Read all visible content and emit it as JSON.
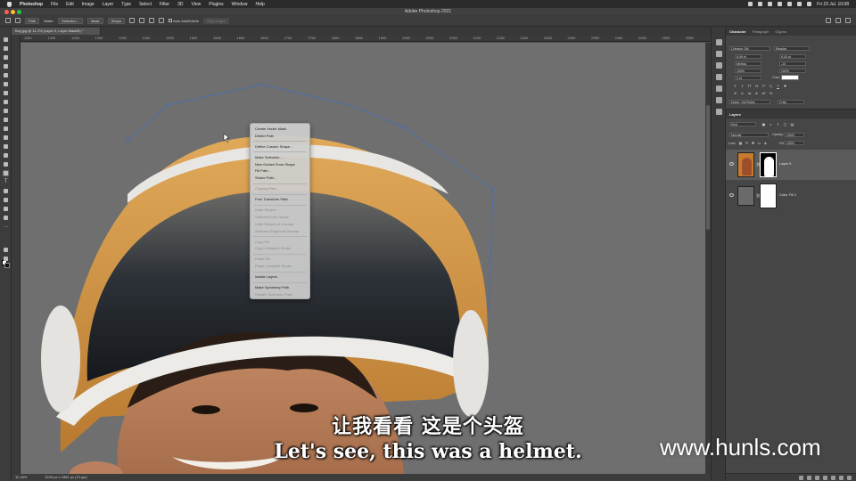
{
  "menubar": {
    "app_name": "Photoshop",
    "items": [
      "File",
      "Edit",
      "Image",
      "Layer",
      "Type",
      "Select",
      "Filter",
      "3D",
      "View",
      "Plugins",
      "Window",
      "Help"
    ],
    "clock": "Fri 23 Jul. 10:08"
  },
  "window": {
    "title": "Adobe Photoshop 2021"
  },
  "options_bar": {
    "mode_value": "Path",
    "make_label": "Make:",
    "selection_button": "Selection...",
    "mask_button": "Mask",
    "shape_button": "Shape",
    "auto_add_delete_label": "Auto Add/Delete",
    "align_edges_label": "Align Edges"
  },
  "document": {
    "tab_title": "Boy.jpg @ 11.2% (Layer 0, Layer Mask/8) *",
    "ruler_ticks": [
      "1150",
      "1200",
      "1250",
      "1300",
      "1350",
      "1400",
      "1450",
      "1500",
      "1550",
      "1600",
      "1650",
      "1700",
      "1750",
      "1800",
      "1850",
      "1900",
      "1950",
      "2000",
      "2050",
      "2100",
      "2150",
      "2200",
      "2250",
      "2300",
      "2350",
      "2400",
      "2450",
      "2500",
      "2550"
    ],
    "zoom": "11.18%",
    "doc_size": "3243 px x 4361 px (72 ppi)"
  },
  "context_menu": {
    "groups": [
      [
        {
          "label": "Create Vector Mask",
          "enabled": true
        },
        {
          "label": "Delete Path",
          "enabled": true
        }
      ],
      [
        {
          "label": "Define Custom Shape...",
          "enabled": true
        }
      ],
      [
        {
          "label": "Make Selection...",
          "enabled": true
        },
        {
          "label": "New Guides From Shape",
          "enabled": true
        },
        {
          "label": "Fill Path...",
          "enabled": true
        },
        {
          "label": "Stroke Path...",
          "enabled": true
        }
      ],
      [
        {
          "label": "Clipping Path...",
          "enabled": false
        }
      ],
      [
        {
          "label": "Free Transform Path",
          "enabled": true
        }
      ],
      [
        {
          "label": "Unite Shapes",
          "enabled": false
        },
        {
          "label": "Subtract Front Shape",
          "enabled": false
        },
        {
          "label": "Unite Shapes at Overlap",
          "enabled": false
        },
        {
          "label": "Subtract Shapes at Overlap",
          "enabled": false
        }
      ],
      [
        {
          "label": "Copy Fill",
          "enabled": false
        },
        {
          "label": "Copy Complete Stroke",
          "enabled": false
        }
      ],
      [
        {
          "label": "Paste Fill",
          "enabled": false
        },
        {
          "label": "Paste Complete Stroke",
          "enabled": false
        }
      ],
      [
        {
          "label": "Isolate Layers",
          "enabled": true
        }
      ],
      [
        {
          "label": "Make Symmetry Path",
          "enabled": true
        },
        {
          "label": "Disable Symmetry Path",
          "enabled": false
        }
      ]
    ]
  },
  "character_panel": {
    "tabs": [
      "Character",
      "Paragraph",
      "Glyphs"
    ],
    "font_family": "Crimson Old",
    "font_style": "Regular",
    "font_size": "6.49 pt",
    "leading": "6.43 pt",
    "kerning": "Metrics",
    "tracking": "-10",
    "vertical_scale": "100%",
    "horizontal_scale": "100%",
    "baseline_shift": "0 pt",
    "color_label": "Color:",
    "format_buttons": [
      "T",
      "T",
      "TT",
      "Tt",
      "T¹",
      "T₁",
      "T",
      "T"
    ],
    "language": "Dutch: Old Rules",
    "antialias": "Crisp"
  },
  "layers_panel": {
    "title": "Layers",
    "kind_filter": "Kind",
    "blend_mode": "Normal",
    "opacity_label": "Opacity:",
    "opacity_value": "100%",
    "lock_label": "Lock:",
    "fill_label": "Fill:",
    "fill_value": "100%",
    "layers": [
      {
        "name": "Layer 0",
        "selected": true
      },
      {
        "name": "Color Fill 1",
        "selected": false
      }
    ]
  },
  "subtitles": {
    "chinese": "让我看看 这是个头盔",
    "english": "Let's see, this was a helmet."
  },
  "watermark": "www.hunls.com",
  "colors": {
    "canvas_bg": "#6f6f6f",
    "path_stroke": "#4d6ea8",
    "helmet_orange": "#c98a3a",
    "panel_bg": "#464646"
  }
}
